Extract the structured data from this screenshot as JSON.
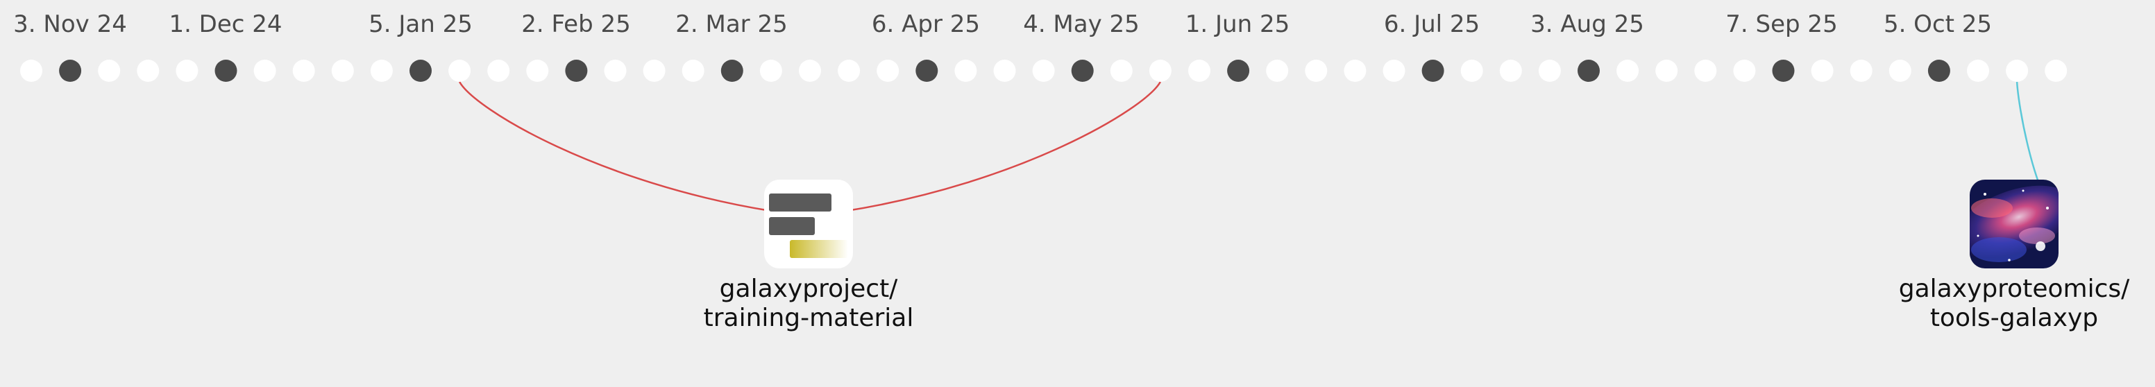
{
  "timeline": {
    "month_labels": [
      "3. Nov 24",
      "1. Dec 24",
      "5. Jan 25",
      "2. Feb 25",
      "2. Mar 25",
      "6. Apr 25",
      "4. May 25",
      "1. Jun 25",
      "6. Jul 25",
      "3. Aug 25",
      "7. Sep 25",
      "5. Oct 25"
    ],
    "week_count": 53,
    "dark_week_indices": [
      1,
      5,
      10,
      14,
      18,
      23,
      27,
      31,
      36,
      40,
      45,
      49
    ],
    "colors": {
      "background": "#efefef",
      "light_dot": "#ffffff",
      "dark_dot": "#4a4a4a",
      "link_red": "#d94a4a",
      "link_cyan": "#5bc8d8"
    }
  },
  "repositories": [
    {
      "name_line1": "galaxyproject/",
      "name_line2": "training-material",
      "icon": "training-material-logo-icon",
      "link_color": "#d94a4a",
      "connected_week_indices": [
        11,
        29
      ]
    },
    {
      "name_line1": "galaxyproteomics/",
      "name_line2": "tools-galaxyp",
      "icon": "galaxy-nebula-icon",
      "link_color": "#5bc8d8",
      "connected_week_indices": [
        51
      ]
    }
  ]
}
